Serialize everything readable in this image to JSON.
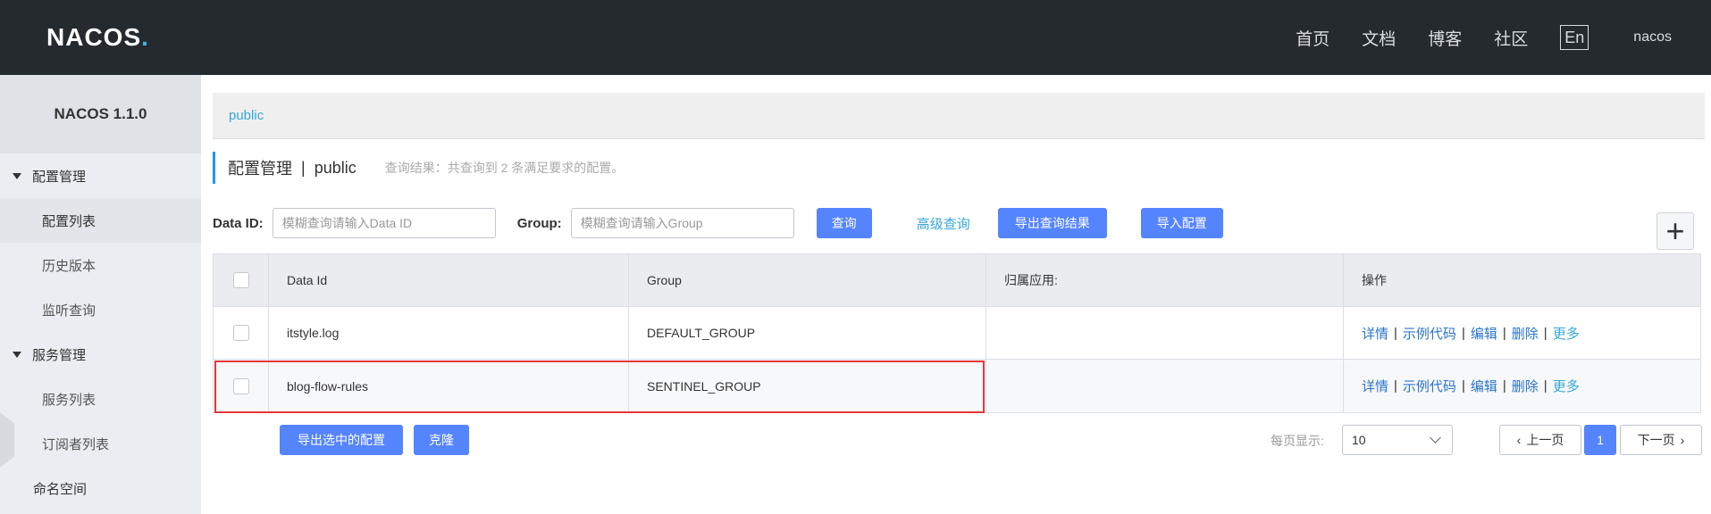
{
  "header": {
    "logo_text": "NACOS",
    "logo_dot": ".",
    "nav": [
      "首页",
      "文档",
      "博客",
      "社区"
    ],
    "lang_button": "En",
    "user": "nacos"
  },
  "sidebar": {
    "version": "NACOS 1.1.0",
    "groups": [
      {
        "label": "配置管理",
        "items": [
          "配置列表",
          "历史版本",
          "监听查询"
        ]
      },
      {
        "label": "服务管理",
        "items": [
          "服务列表",
          "订阅者列表"
        ]
      }
    ],
    "plain_item": "命名空间"
  },
  "namespace_bar": {
    "namespace": "public"
  },
  "page_title": {
    "title": "配置管理",
    "separator": "|",
    "namespace": "public",
    "result_text": "查询结果：共查询到 2 条满足要求的配置。"
  },
  "filter": {
    "data_id_label": "Data ID:",
    "data_id_placeholder": "模糊查询请输入Data ID",
    "group_label": "Group:",
    "group_placeholder": "模糊查询请输入Group",
    "query_button": "查询",
    "advanced_query": "高级查询",
    "export_results_button": "导出查询结果",
    "import_button": "导入配置",
    "add_button": "+"
  },
  "table": {
    "columns": [
      "Data Id",
      "Group",
      "归属应用:",
      "操作"
    ],
    "rows": [
      {
        "data_id": "itstyle.log",
        "group": "DEFAULT_GROUP",
        "app": ""
      },
      {
        "data_id": "blog-flow-rules",
        "group": "SENTINEL_GROUP",
        "app": ""
      }
    ],
    "ops": {
      "details": "详情",
      "sample_code": "示例代码",
      "edit": "编辑",
      "delete": "删除",
      "more": "更多",
      "sep": "|"
    }
  },
  "bottom": {
    "export_selected_button": "导出选中的配置",
    "clone_button": "克隆",
    "page_size_label": "每页显示:",
    "page_size_value": "10",
    "prev_button": "上一页",
    "current_page": "1",
    "next_button": "下一页"
  }
}
